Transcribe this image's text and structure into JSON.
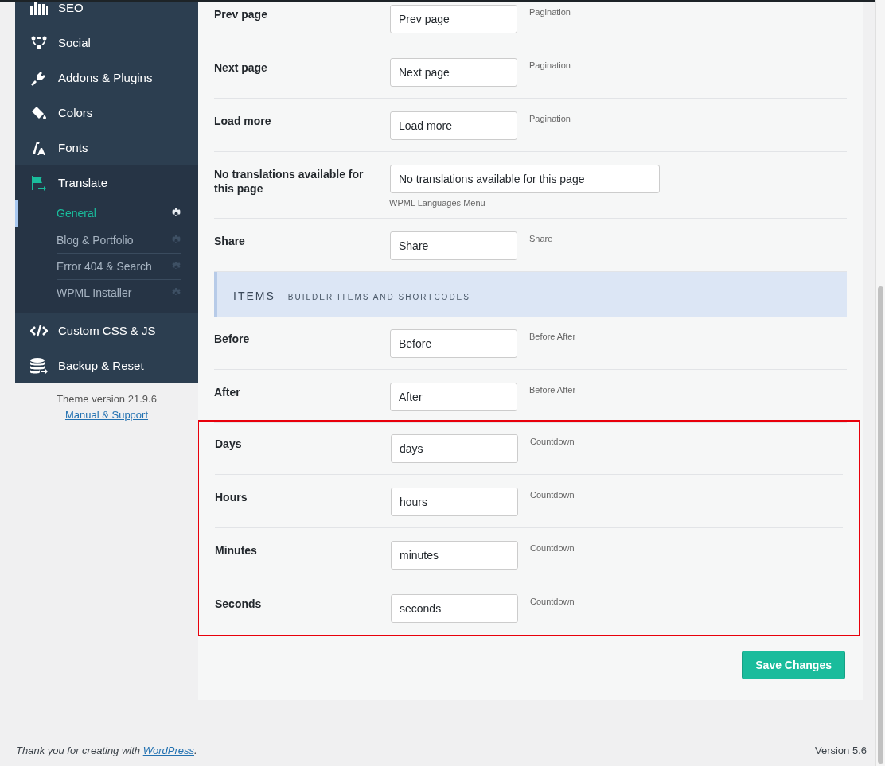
{
  "sidebar": {
    "items": [
      {
        "label": "SEO"
      },
      {
        "label": "Social"
      },
      {
        "label": "Addons & Plugins"
      },
      {
        "label": "Colors"
      },
      {
        "label": "Fonts"
      },
      {
        "label": "Translate",
        "expanded": true,
        "children": [
          {
            "label": "General",
            "selected": true
          },
          {
            "label": "Blog & Portfolio",
            "selected": false
          },
          {
            "label": "Error 404 & Search",
            "selected": false
          },
          {
            "label": "WPML Installer",
            "selected": false
          }
        ]
      },
      {
        "label": "Custom CSS & JS"
      },
      {
        "label": "Backup & Reset"
      }
    ],
    "theme_version": "Theme version 21.9.6",
    "support_link": "Manual & Support"
  },
  "sections": [
    {
      "kind": "rows",
      "highlighted": false,
      "rows": [
        {
          "label": "Prev page",
          "value": "Prev page",
          "note": "Pagination",
          "kind": "short"
        },
        {
          "label": "Next page",
          "value": "Next page",
          "note": "Pagination",
          "kind": "short"
        },
        {
          "label": "Load more",
          "value": "Load more",
          "note": "Pagination",
          "kind": "short"
        },
        {
          "label": "No translations available for this page",
          "value": "No translations available for this page",
          "note": "WPML Languages Menu",
          "kind": "wide"
        },
        {
          "label": "Share",
          "value": "Share",
          "note": "Share",
          "kind": "short"
        }
      ]
    },
    {
      "kind": "header",
      "title": "ITEMS",
      "subtitle": "BUILDER ITEMS AND SHORTCODES"
    },
    {
      "kind": "rows",
      "highlighted": false,
      "rows": [
        {
          "label": "Before",
          "value": "Before",
          "note": "Before After",
          "kind": "short"
        },
        {
          "label": "After",
          "value": "After",
          "note": "Before After",
          "kind": "short"
        }
      ]
    },
    {
      "kind": "rows",
      "highlighted": true,
      "rows": [
        {
          "label": "Days",
          "value": "days",
          "note": "Countdown",
          "kind": "short"
        },
        {
          "label": "Hours",
          "value": "hours",
          "note": "Countdown",
          "kind": "short"
        },
        {
          "label": "Minutes",
          "value": "minutes",
          "note": "Countdown",
          "kind": "short"
        },
        {
          "label": "Seconds",
          "value": "seconds",
          "note": "Countdown",
          "kind": "short"
        }
      ]
    }
  ],
  "save_button": "Save Changes",
  "footer": {
    "before": "Thank you for creating with",
    "link": "WordPress",
    "after": ".",
    "version": "Version 5.6"
  }
}
